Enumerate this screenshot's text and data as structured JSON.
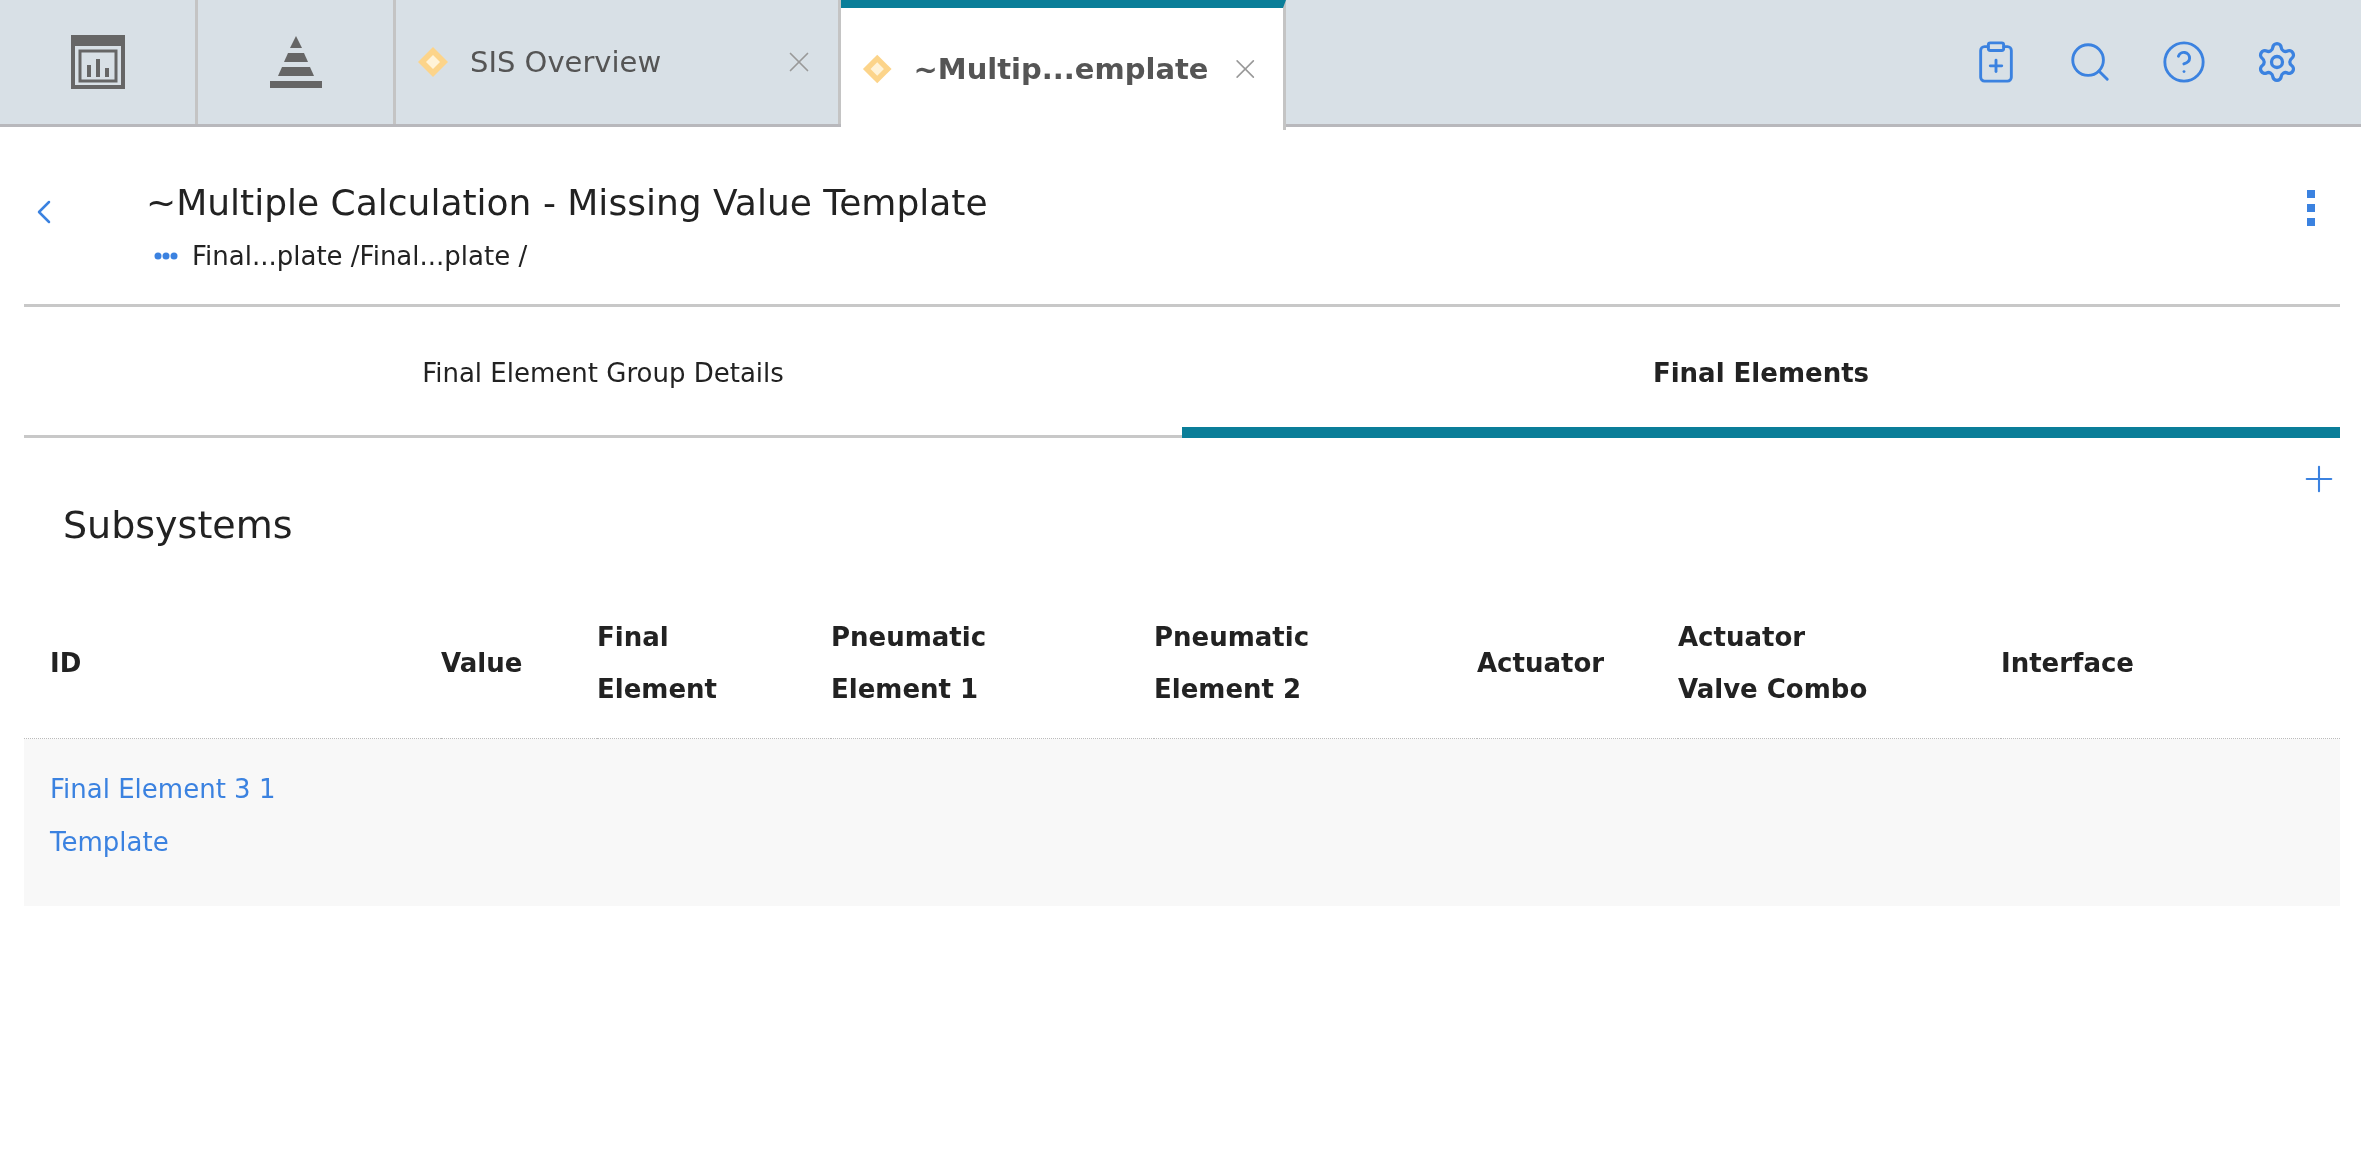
{
  "top_tabs": [
    {
      "kind": "icon",
      "selected": false
    },
    {
      "kind": "icon",
      "selected": false
    },
    {
      "kind": "document",
      "label": "SIS Overview",
      "selected": false
    },
    {
      "kind": "document",
      "label": "~Multip...emplate",
      "selected": true
    }
  ],
  "header": {
    "title": "~Multiple Calculation - Missing Value Template",
    "breadcrumb": "Final...plate /Final...plate /"
  },
  "tabs": [
    {
      "label": "Final Element Group Details",
      "selected": false
    },
    {
      "label": "Final Elements",
      "selected": true
    }
  ],
  "section": {
    "title": "Subsystems"
  },
  "table": {
    "columns": [
      "ID",
      "Value",
      "Final Element",
      "Pneumatic Element 1",
      "Pneumatic Element 2",
      "Actuator",
      "Actuator Valve Combo",
      "Interface"
    ],
    "rows": [
      {
        "cells": [
          "Final Element 3 1 Template",
          "",
          "",
          "",
          "",
          "",
          "",
          ""
        ]
      }
    ]
  }
}
